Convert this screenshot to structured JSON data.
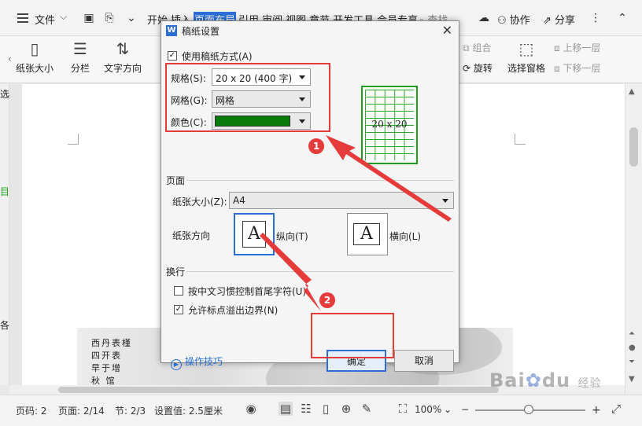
{
  "menubar": {
    "file_label": "文件",
    "tabs": [
      "开始",
      "插入",
      "页面布局",
      "引用",
      "审阅",
      "视图",
      "章节",
      "开发工具",
      "会员专享"
    ],
    "search_label": "查找",
    "collab_label": "协作",
    "share_label": "分享"
  },
  "ribbon": {
    "items": [
      "纸张大小",
      "分栏",
      "文字方向"
    ],
    "right_items": [
      "组合",
      "旋转",
      "选择窗格",
      "上移一层",
      "下移一层"
    ]
  },
  "dialog": {
    "title": "稿纸设置",
    "use_grid_label": "使用稿纸方式(A)",
    "use_grid_checked": true,
    "spec_label": "规格(S):",
    "spec_value": "20 x 20 (400 字)",
    "grid_label": "网格(G):",
    "grid_value": "网格",
    "color_label": "颜色(C):",
    "color_value": "#0a7a0a",
    "preview_text": "20 x 20",
    "page_section": "页面",
    "paper_size_label": "纸张大小(Z):",
    "paper_size_value": "A4",
    "orientation_label": "纸张方向",
    "portrait_label": "纵向(T)",
    "landscape_label": "横向(L)",
    "orient_glyph": "A",
    "wrap_section": "换行",
    "wrap_option1": "按中文习惯控制首尾字符(U)",
    "wrap_option1_checked": false,
    "wrap_option2": "允许标点溢出边界(N)",
    "wrap_option2_checked": true,
    "tips_label": "操作技巧",
    "ok_label": "确定",
    "cancel_label": "取消"
  },
  "annotations": {
    "badge1": "1",
    "badge2": "2",
    "box_color": "#e53b3b"
  },
  "painting": {
    "poem_lines": [
      "西丹表槿",
      "四开表",
      "早于增",
      "秋 馆"
    ]
  },
  "statusbar": {
    "page_no": "页码: 2",
    "pages": "页面: 2/14",
    "section": "节: 2/3",
    "setting": "设置值: 2.5厘米",
    "zoom": "100%"
  },
  "left_strip": {
    "chars": [
      "选",
      "目",
      "各"
    ]
  },
  "watermark": {
    "brand": "Bai",
    "brand2": "du",
    "sub": "经验"
  }
}
